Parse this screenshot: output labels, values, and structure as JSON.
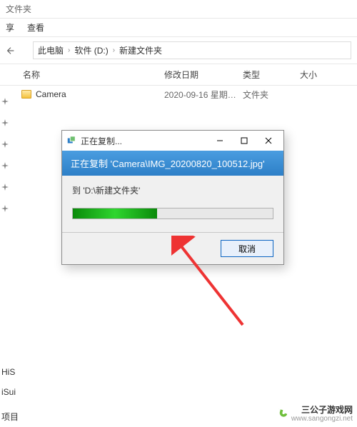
{
  "window": {
    "title_fragment": "文件夹"
  },
  "menu": {
    "share": "享",
    "view": "查看"
  },
  "breadcrumbs": {
    "root": "此电脑",
    "drive": "软件 (D:)",
    "folder": "新建文件夹"
  },
  "columns": {
    "name": "名称",
    "date": "修改日期",
    "type": "类型",
    "size": "大小"
  },
  "files": [
    {
      "name": "Camera",
      "date": "2020-09-16 星期…",
      "type": "文件夹"
    }
  ],
  "side": {
    "frag1": "HiS",
    "frag2": "iSui",
    "status": "项目"
  },
  "dialog": {
    "title": "正在复制...",
    "header": "正在复制 'Camera\\IMG_20200820_100512.jpg'",
    "dest": "到 'D:\\新建文件夹'",
    "progress_pct": 42,
    "cancel": "取消"
  },
  "watermark": {
    "name": "三公子游戏网",
    "url": "www.sangongzi.net"
  }
}
